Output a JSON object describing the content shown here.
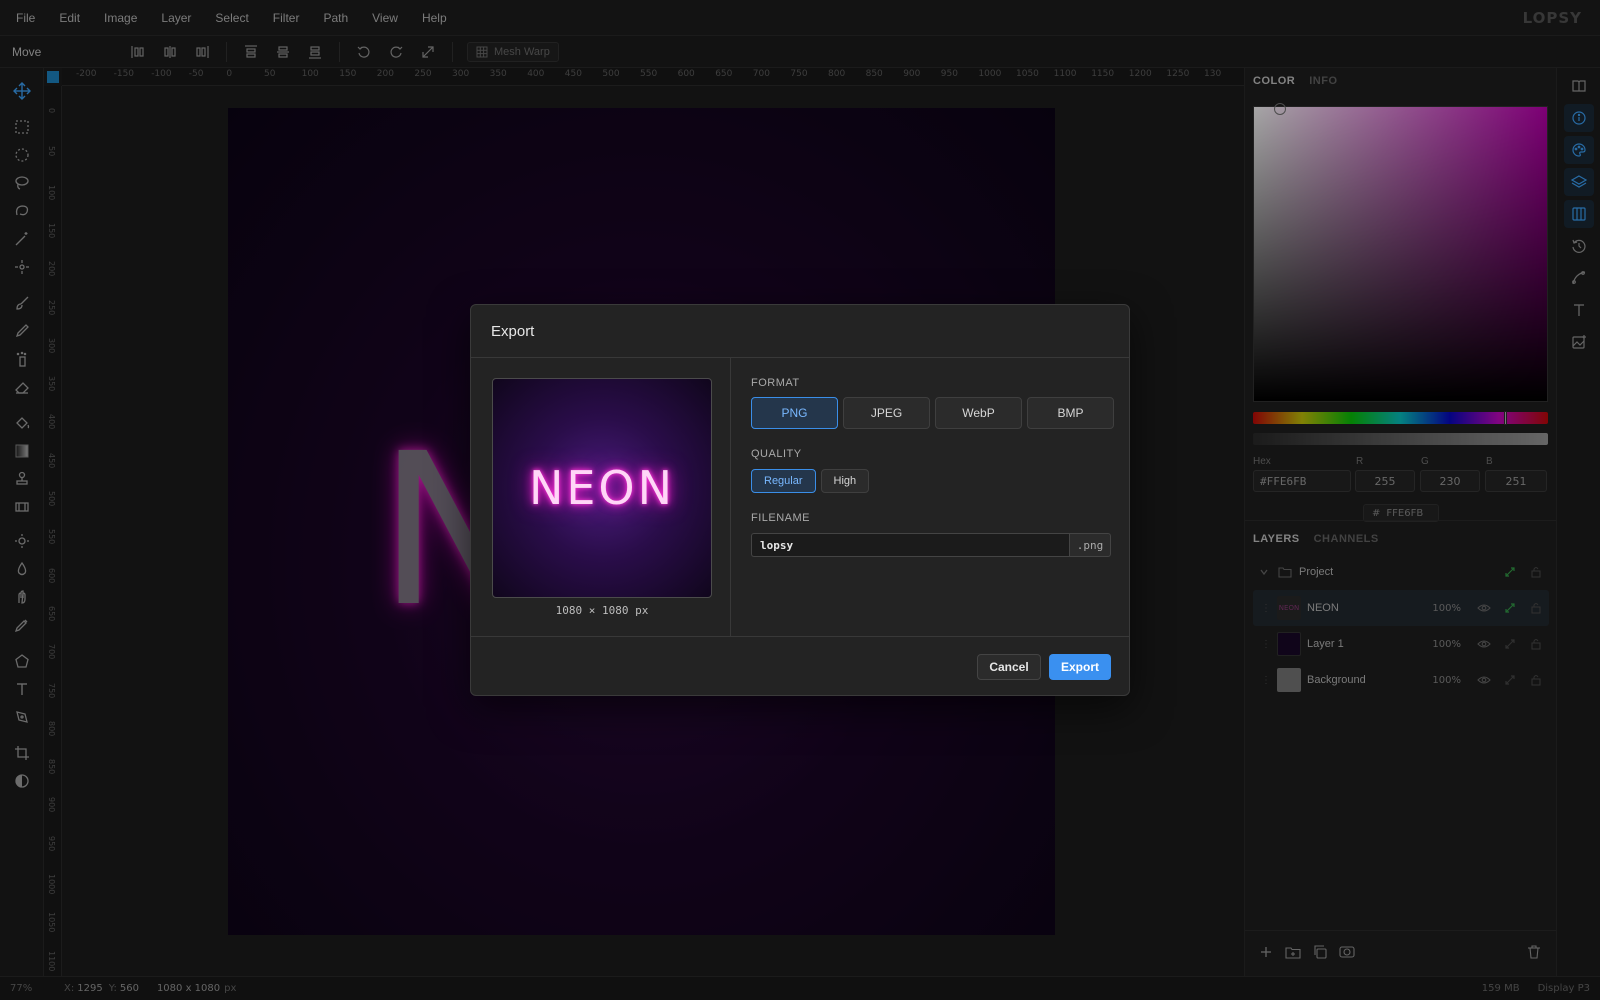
{
  "menu": [
    "File",
    "Edit",
    "Image",
    "Layer",
    "Select",
    "Filter",
    "Path",
    "View",
    "Help"
  ],
  "brand": "LOPSY",
  "options": {
    "tool_name": "Move",
    "mesh_warp": "Mesh Warp"
  },
  "ruler": {
    "h": [
      "-200",
      "-150",
      "-100",
      "-50",
      "0",
      "50",
      "100",
      "150",
      "200",
      "250",
      "300",
      "350",
      "400",
      "450",
      "500",
      "550",
      "600",
      "650",
      "700",
      "750",
      "800",
      "850",
      "900",
      "950",
      "1000",
      "1050",
      "1100",
      "1150",
      "1200",
      "1250",
      "130"
    ],
    "v": [
      "0",
      "50",
      "100",
      "150",
      "200",
      "250",
      "300",
      "350",
      "400",
      "450",
      "500",
      "550",
      "600",
      "650",
      "700",
      "750",
      "800",
      "850",
      "900",
      "950",
      "1000",
      "1050",
      "1100"
    ]
  },
  "canvas": {
    "letter": "N"
  },
  "panel": {
    "tabs": [
      "COLOR",
      "INFO"
    ],
    "labels": {
      "hex": "Hex",
      "r": "R",
      "g": "G",
      "b": "B"
    },
    "values": {
      "hex": "#FFE6FB",
      "r": "255",
      "g": "230",
      "b": "251"
    },
    "badge_hash": "#",
    "badge": "FFE6FB",
    "hue_position": 0.85,
    "layer_tabs": [
      "LAYERS",
      "CHANNELS"
    ],
    "group": "Project",
    "layers": [
      {
        "name": "NEON",
        "opacity": "100%",
        "thumb": "NEON"
      },
      {
        "name": "Layer 1",
        "opacity": "100%",
        "thumb": ""
      },
      {
        "name": "Background",
        "opacity": "100%",
        "thumb": ""
      }
    ]
  },
  "status": {
    "zoom": "77%",
    "x_label": "X:",
    "x": "1295",
    "y_label": "Y:",
    "y": "560",
    "size": "1080 x 1080",
    "size_unit": "px",
    "memory": "159 MB",
    "profile": "Display P3"
  },
  "dialog": {
    "title": "Export",
    "preview_text": "NEON",
    "preview_dims": "1080 × 1080 px",
    "format_label": "FORMAT",
    "formats": [
      "PNG",
      "JPEG",
      "WebP",
      "BMP"
    ],
    "quality_label": "QUALITY",
    "qualities": [
      "Regular",
      "High"
    ],
    "filename_label": "FILENAME",
    "filename": "lopsy",
    "extension": ".png",
    "cancel": "Cancel",
    "export": "Export"
  }
}
